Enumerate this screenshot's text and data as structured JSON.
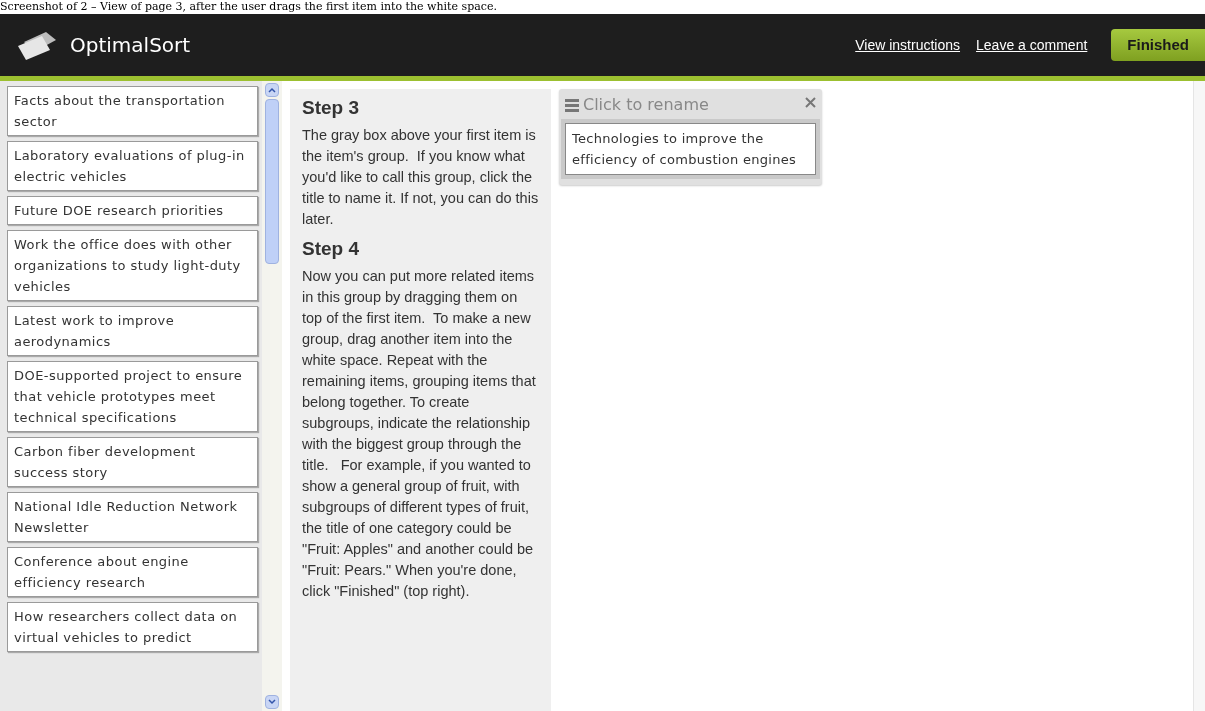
{
  "caption": "Screenshot of 2 – View of page 3, after the user drags the first item into the white space.",
  "header": {
    "brand": "OptimalSort",
    "links": [
      "View instructions",
      "Leave a comment"
    ],
    "finish_button": "Finished"
  },
  "cards": [
    "Facts about the transportation sector",
    "Laboratory evaluations of plug-in electric vehicles",
    "Future DOE research priorities",
    "Work the office does with other organizations to study light-duty vehicles",
    "Latest work to improve aerodynamics",
    "DOE-supported project to ensure that vehicle prototypes meet technical specifications",
    "Carbon fiber development success story",
    "National Idle Reduction Network Newsletter",
    "Conference about engine efficiency research",
    "How researchers collect data on virtual vehicles to predict"
  ],
  "instructions": [
    {
      "heading": "Step 3",
      "text": "The gray box above your first item is the item's group.  If you know what you'd like to call this group, click the title to name it. If not, you can do this later."
    },
    {
      "heading": "Step 4",
      "text": "Now you can put more related items in this group by dragging them on top of the first item.  To make a new group, drag another item into the white space. Repeat with the remaining items, grouping items that belong together. To create subgroups, indicate the relationship with the biggest group through the title.   For example, if you wanted to show a general group of fruit, with subgroups of different types of fruit, the title of one category could be \"Fruit: Apples\" and another could be \"Fruit: Pears.\" When you're done, click \"Finished\" (top right)."
    }
  ],
  "groups": [
    {
      "title": "Click to rename",
      "cards": [
        "Technologies to improve the efficiency of combustion engines"
      ]
    }
  ]
}
